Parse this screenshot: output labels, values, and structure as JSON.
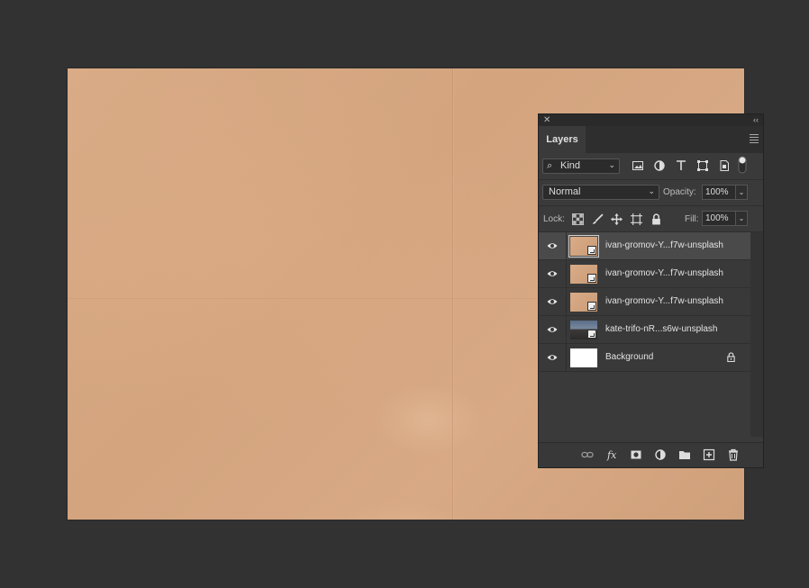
{
  "panel": {
    "close_glyph": "✕",
    "collapse_glyph": "‹‹",
    "tab_label": "Layers",
    "filter": {
      "kind_label": "Kind"
    },
    "blend": {
      "mode": "Normal",
      "opacity_label": "Opacity:",
      "opacity_value": "100%"
    },
    "lock": {
      "label": "Lock:",
      "fill_label": "Fill:",
      "fill_value": "100%"
    },
    "layers": [
      {
        "name": "ivan-gromov-Y...f7w-unsplash",
        "thumb": "paper",
        "selected": true
      },
      {
        "name": "ivan-gromov-Y...f7w-unsplash",
        "thumb": "paper",
        "selected": false
      },
      {
        "name": "ivan-gromov-Y...f7w-unsplash",
        "thumb": "paper",
        "selected": false
      },
      {
        "name": "kate-trifo-nR...s6w-unsplash",
        "thumb": "photo",
        "selected": false
      },
      {
        "name": "Background",
        "thumb": "white",
        "selected": false,
        "locked": true
      }
    ],
    "icons": {
      "filter": [
        "image-filter-icon",
        "adjustment-filter-icon",
        "type-filter-icon",
        "shape-filter-icon",
        "smart-object-filter-icon",
        "filter-toggle-icon"
      ],
      "lock": [
        "lock-transparent-icon",
        "lock-image-icon",
        "lock-position-icon",
        "lock-artboard-icon",
        "lock-all-icon"
      ],
      "footer": [
        "link-layers-icon",
        "fx-icon",
        "layer-mask-icon",
        "adjustment-layer-icon",
        "new-group-icon",
        "new-layer-icon",
        "delete-layer-icon"
      ]
    }
  },
  "colors": {
    "workspace": "#323232",
    "panel": "#3a3a3a",
    "paper": "#d6a882",
    "selected_row": "#4a4a4a"
  }
}
